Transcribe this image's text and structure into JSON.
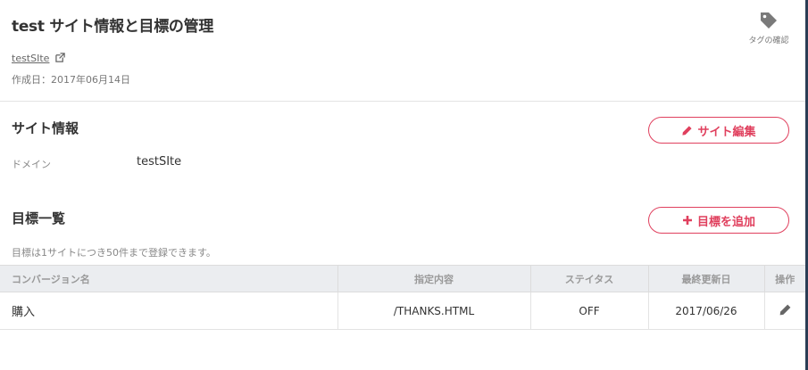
{
  "header": {
    "title": "test サイト情報と目標の管理",
    "site_link": "testSIte",
    "created": "作成日：2017年06月14日",
    "tag_confirm_label": "タグの確認"
  },
  "site_info": {
    "title": "サイト情報",
    "edit_button": "サイト編集",
    "domain_label": "ドメイン",
    "domain_value": "testSIte"
  },
  "goals": {
    "title": "目標一覧",
    "add_button": "目標を追加",
    "note": "目標は1サイトにつき50件まで登録できます。",
    "columns": [
      "コンバージョン名",
      "指定内容",
      "ステイタス",
      "最終更新日",
      "操作"
    ],
    "rows": [
      {
        "name": "購入",
        "spec": "/THANKS.HTML",
        "status": "OFF",
        "updated": "2017/06/26"
      }
    ]
  },
  "colors": {
    "accent": "#e0405e",
    "table_header_bg": "#ebedf0",
    "edge": "#2a3d55"
  },
  "icons": [
    "external-link-icon",
    "tag-icon",
    "pencil-icon",
    "plus-icon"
  ]
}
